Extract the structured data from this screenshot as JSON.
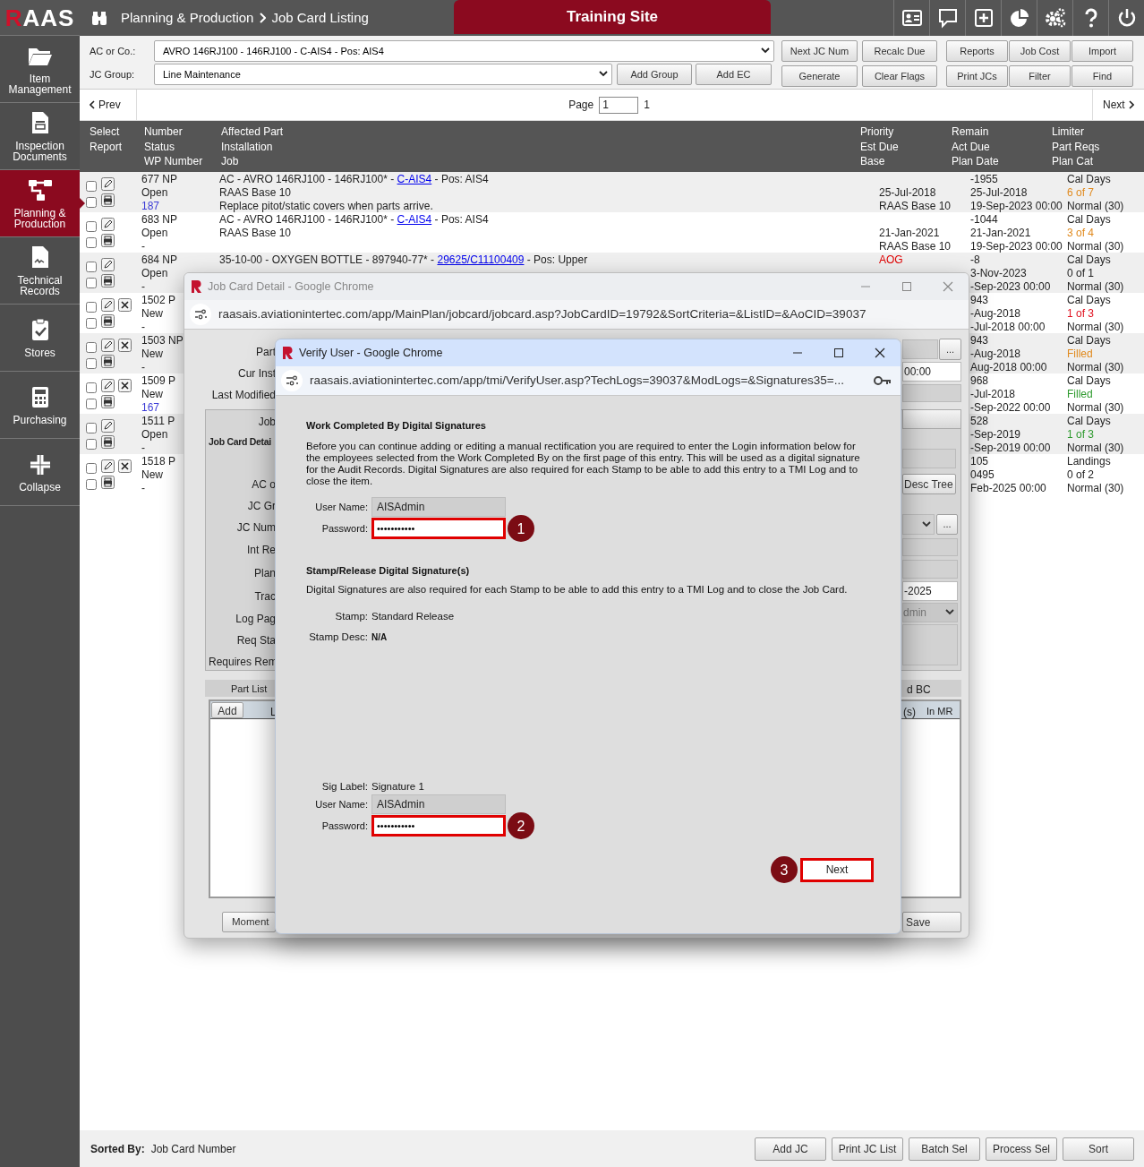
{
  "sidebar": {
    "logo": {
      "accent": "R",
      "rest": "AAS"
    },
    "items": [
      {
        "label": "Item Management",
        "selected": false
      },
      {
        "label": "Inspection Documents",
        "selected": false
      },
      {
        "label": "Planning & Production",
        "selected": true
      },
      {
        "label": "Technical Records",
        "selected": false
      },
      {
        "label": "Stores",
        "selected": false
      },
      {
        "label": "Purchasing",
        "selected": false
      },
      {
        "label": "Collapse",
        "selected": false
      }
    ]
  },
  "header": {
    "breadcrumb": [
      "Planning & Production",
      "Job Card Listing"
    ],
    "site_banner": "Training Site"
  },
  "filters": {
    "ac_label": "AC or Co.:",
    "ac_value": "AVRO 146RJ100 - 146RJ100 - C-AIS4 - Pos: AIS4",
    "group_label": "JC Group:",
    "group_value": "Line Maintenance",
    "group_buttons": [
      "Add Group",
      "Add EC"
    ],
    "button_rows": [
      [
        "Next JC Num",
        "Recalc Due",
        "Reports",
        "Job Cost",
        "Import"
      ],
      [
        "Generate",
        "Clear Flags",
        "Print JCs",
        "Filter",
        "Find"
      ]
    ]
  },
  "pager": {
    "prev": "Prev",
    "page_label": "Page",
    "page_value": "1",
    "page_count": "1",
    "next": "Next"
  },
  "table": {
    "columns": [
      [
        "Select",
        "Report"
      ],
      [
        "Number",
        "Status",
        "WP Number"
      ],
      [
        "Affected Part",
        "Installation",
        "Job"
      ],
      [
        "Priority",
        "Est Due",
        "Base"
      ],
      [
        "Remain",
        "Act Due",
        "Plan Date"
      ],
      [
        "Limiter",
        "Part Reqs",
        "Plan Cat"
      ]
    ],
    "rows": [
      {
        "select_checked": false,
        "report_checked": false,
        "deletable": false,
        "number": "677 NP",
        "status": "Open",
        "wp": "187",
        "wp_link": true,
        "affected": {
          "prefix": "AC - AVRO 146RJ100 - 146RJ100* - ",
          "link": "C-AIS4",
          "suffix": " - Pos: AIS4"
        },
        "installation": "RAAS Base 10",
        "job": "Replace pitot/static covers when parts arrive.",
        "est_due": "25-Jul-2018",
        "base": "RAAS Base 10",
        "remain": "-1955",
        "act_due": "25-Jul-2018",
        "plan_date": "19-Sep-2023 00:00",
        "limiter": "Cal Days",
        "part_reqs": {
          "text": "6 of 7",
          "color": "#e08a1e"
        },
        "plan_cat": "Normal (30)"
      },
      {
        "select_checked": false,
        "report_checked": false,
        "deletable": false,
        "number": "683 NP",
        "status": "Open",
        "wp": "-",
        "wp_link": false,
        "affected": {
          "prefix": "AC - AVRO 146RJ100 - 146RJ100* - ",
          "link": "C-AIS4",
          "suffix": " - Pos: AIS4"
        },
        "installation": "RAAS Base 10",
        "est_due": "21-Jan-2021",
        "base": "RAAS Base 10",
        "remain": "-1044",
        "act_due": "21-Jan-2021",
        "plan_date": "19-Sep-2023 00:00",
        "limiter": "Cal Days",
        "part_reqs": {
          "text": "3 of 4",
          "color": "#e08a1e"
        },
        "plan_cat": "Normal (30)"
      },
      {
        "select_checked": false,
        "report_checked": false,
        "deletable": false,
        "number": "684 NP",
        "status": "Open",
        "wp": "-",
        "wp_link": false,
        "affected": {
          "prefix": "35-10-00 - OXYGEN BOTTLE - 897940-77* - ",
          "link": "29625/C11100409",
          "suffix": " - Pos: Upper"
        },
        "priority": {
          "text": "AOG",
          "color": "#e00000"
        },
        "remain": "-8",
        "act_due": "3-Nov-2023",
        "plan_date": "-Sep-2023 00:00",
        "limiter": "Cal Days",
        "part_reqs": {
          "text": "0 of 1",
          "color": "#222222"
        },
        "plan_cat": "Normal (30)"
      },
      {
        "select_checked": false,
        "report_checked": false,
        "deletable": true,
        "number": "1502 P",
        "status": "New",
        "wp": "-",
        "wp_link": false,
        "remain": "943",
        "act_due": "-Aug-2018",
        "plan_date": "-Jul-2018 00:00",
        "limiter": "Cal Days",
        "part_reqs": {
          "text": "1 of 3",
          "color": "#e0101e"
        },
        "plan_cat": "Normal (30)"
      },
      {
        "select_checked": false,
        "report_checked": false,
        "deletable": true,
        "number": "1503 NP",
        "status": "New",
        "wp": "-",
        "wp_link": false,
        "remain": "943",
        "act_due": "-Aug-2018",
        "plan_date": "Aug-2018 00:00",
        "limiter": "Cal Days",
        "part_reqs": {
          "text": "Filled",
          "color": "#e08a1e"
        },
        "plan_cat": "Normal (30)"
      },
      {
        "select_checked": false,
        "report_checked": false,
        "deletable": true,
        "number": "1509 P",
        "status": "New",
        "wp": "167",
        "wp_link": true,
        "remain": "968",
        "act_due": "-Jul-2018",
        "plan_date": "-Sep-2022 00:00",
        "limiter": "Cal Days",
        "part_reqs": {
          "text": "Filled",
          "color": "#2e9a2e"
        },
        "plan_cat": "Normal (30)"
      },
      {
        "select_checked": false,
        "report_checked": false,
        "deletable": false,
        "number": "1511 P",
        "status": "Open",
        "wp": "-",
        "wp_link": false,
        "remain": "528",
        "act_due": "-Sep-2019",
        "plan_date": "-Sep-2019 00:00",
        "limiter": "Cal Days",
        "part_reqs": {
          "text": "1 of 3",
          "color": "#2e9a2e"
        },
        "plan_cat": "Normal (30)"
      },
      {
        "select_checked": false,
        "report_checked": false,
        "deletable": true,
        "number": "1518 P",
        "status": "New",
        "wp": "-",
        "wp_link": false,
        "remain": "105",
        "act_due": "0495",
        "plan_date": "Feb-2025 00:00",
        "limiter": "Landings",
        "part_reqs": {
          "text": "0 of 2",
          "color": "#222222"
        },
        "plan_cat": "Normal (30)"
      }
    ]
  },
  "job_card_window": {
    "title": "Job Card Detail - Google Chrome",
    "url": "raasais.aviationintertec.com/app/MainPlan/jobcard/jobcard.asp?JobCardID=19792&SortCriteria=&ListID=&AoCID=39037",
    "labels": [
      "Part",
      "Cur Inst",
      "Last Modified"
    ],
    "panel_title": "Job Card Detai",
    "panel_labels": [
      "Job",
      "AC o",
      "JC Gr",
      "JC Num",
      "Int Re",
      "Plan",
      "Trac",
      "Log Pag",
      "Req Sta"
    ],
    "requires_label": "Requires Rem",
    "time_value": "00:00",
    "date_value": "-2025",
    "user_value": "dmin",
    "desc_tree_button": "Desc Tree",
    "ellipsis_buttons": [
      "...",
      "..."
    ],
    "part_list": {
      "title": "Part List",
      "title_end": "d BC",
      "add_button": "Add",
      "columns": [
        "L",
        "(s)",
        "In MR"
      ]
    },
    "moment_button": "Moment",
    "save_button": "Save"
  },
  "verify_window": {
    "title": "Verify User - Google Chrome",
    "url": "raasais.aviationintertec.com/app/tmi/VerifyUser.asp?TechLogs=39037&ModLogs=&Signatures35=...",
    "work_heading": "Work Completed By Digital Signatures",
    "work_text": "Before you can continue adding or editing a manual rectification you are required to enter the Login information below for the employees selected from the Work Completed By on the first page of this entry. This will be used as a digital signature for the Audit Records. Digital Signatures are also required for each Stamp to be able to add this entry to a TMI Log and to close the item.",
    "user_label": "User Name:",
    "user_value": "AISAdmin",
    "password_label": "Password:",
    "password_value": "•••••••••••",
    "password_step": "1",
    "stamp_heading": "Stamp/Release Digital Signature(s)",
    "stamp_text": "Digital Signatures are also required for each Stamp to be able to add this entry to a TMI Log and to close the Job Card.",
    "stamp_label": "Stamp:",
    "stamp_value": "Standard Release",
    "stamp_desc_label": "Stamp Desc:",
    "stamp_desc_value": "N/A",
    "signature": {
      "sig_label": "Sig Label:",
      "sig_value": "Signature 1",
      "user_label": "User Name:",
      "user_value": "AISAdmin",
      "password_label": "Password:",
      "password_value": "•••••••••••",
      "step": "2"
    },
    "next_button": "Next",
    "next_step": "3"
  },
  "footer": {
    "sorted_label": "Sorted By:",
    "sorted_value": "Job Card Number",
    "buttons": [
      "Add JC",
      "Print JC List",
      "Batch Sel",
      "Process Sel",
      "Sort"
    ]
  }
}
